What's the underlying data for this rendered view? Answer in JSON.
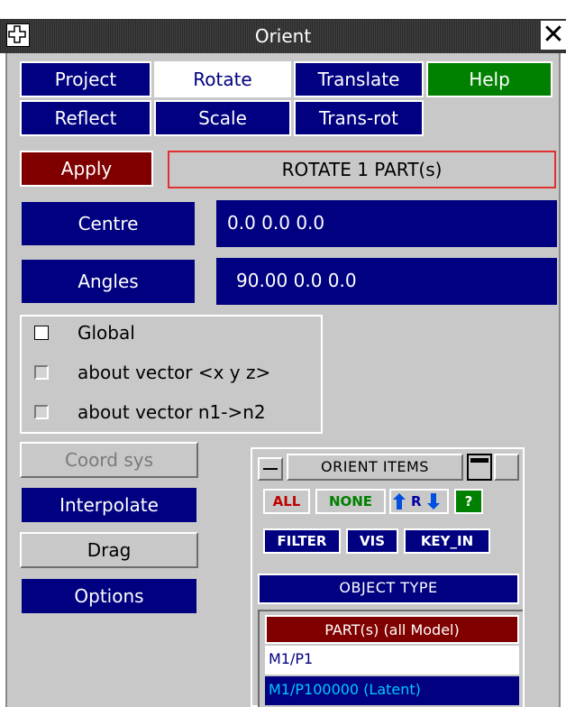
{
  "window": {
    "title": "Orient",
    "move_icon": "move-cross-icon",
    "close_icon": "close-x-icon",
    "close_glyph": "✕"
  },
  "tabs": [
    {
      "label": "Project",
      "active": false
    },
    {
      "label": "Rotate",
      "active": true
    },
    {
      "label": "Translate",
      "active": false
    },
    {
      "label": "Help",
      "active": false
    },
    {
      "label": "Reflect",
      "active": false
    },
    {
      "label": "Scale",
      "active": false
    },
    {
      "label": "Trans-rot",
      "active": false
    }
  ],
  "apply": {
    "label": "Apply",
    "status": "ROTATE 1 PART(s)"
  },
  "centre": {
    "label": "Centre",
    "value": "0.0  0.0  0.0"
  },
  "angles": {
    "label": "Angles",
    "value": "90.00  0.0  0.0"
  },
  "axis_options": [
    {
      "label": "Global",
      "selected": true
    },
    {
      "label": "about vector <x y z>",
      "selected": false
    },
    {
      "label": "about vector n1->n2",
      "selected": false
    }
  ],
  "side_buttons": {
    "coord_sys": "Coord sys",
    "interpolate": "Interpolate",
    "drag": "Drag",
    "options": "Options"
  },
  "orient_items": {
    "title": "ORIENT ITEMS",
    "all": "ALL",
    "none": "NONE",
    "rev": "R",
    "help": "?",
    "filter": "FILTER",
    "vis": "VIS",
    "key_in": "KEY_IN",
    "object_type": "OBJECT TYPE",
    "header": "PART(s) (all Model)",
    "items": [
      {
        "label": "M1/P1",
        "selected": false
      },
      {
        "label": "M1/P100000 (Latent)",
        "selected": true
      }
    ]
  },
  "colors": {
    "navy": "#000080",
    "dark_red": "#800000",
    "green": "#008000",
    "panel_grey": "#c8c8c8",
    "cyan_text": "#00c8ff"
  }
}
